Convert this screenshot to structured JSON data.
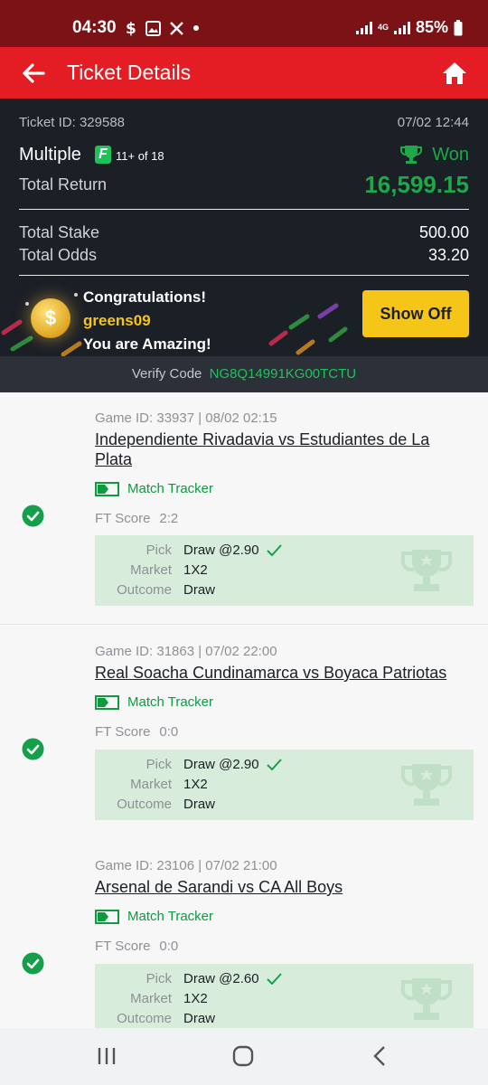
{
  "status_bar": {
    "time": "04:30",
    "battery": "85%",
    "network_tag": "4G"
  },
  "header": {
    "title": "Ticket Details"
  },
  "summary": {
    "ticket_id": "Ticket ID: 329588",
    "date": "07/02 12:44",
    "bet_type": "Multiple",
    "flex_badge": "F",
    "flex_text": "11+ of 18",
    "status": "Won",
    "total_return_label": "Total Return",
    "total_return_value": "16,599.15",
    "total_stake_label": "Total Stake",
    "total_stake_value": "500.00",
    "total_odds_label": "Total Odds",
    "total_odds_value": "33.20"
  },
  "congrats": {
    "line1": "Congratulations!",
    "username": "greens09",
    "line3": "You are Amazing!",
    "coin_symbol": "$",
    "show_off_label": "Show Off"
  },
  "verify": {
    "label": "Verify Code",
    "code": "NG8Q14991KG00TCTU"
  },
  "labels": {
    "match_tracker": "Match Tracker",
    "ft_score": "FT Score",
    "pick": "Pick",
    "market": "Market",
    "outcome": "Outcome"
  },
  "games": [
    {
      "meta": "Game ID: 33937 | 08/02 02:15",
      "title": "Independiente Rivadavia vs Estudiantes de La Plata",
      "ft_score": "2:2",
      "pick": "Draw @2.90",
      "market": "1X2",
      "outcome": "Draw"
    },
    {
      "meta": "Game ID: 31863 | 07/02 22:00",
      "title": "Real Soacha Cundinamarca vs Boyaca Patriotas",
      "ft_score": "0:0",
      "pick": "Draw @2.90",
      "market": "1X2",
      "outcome": "Draw"
    },
    {
      "meta": "Game ID: 23106 | 07/02 21:00",
      "title": "Arsenal de Sarandi vs CA All Boys",
      "ft_score": "0:0",
      "pick": "Draw @2.60",
      "market": "1X2",
      "outcome": "Draw"
    }
  ],
  "icons": {
    "status": [
      "dollar-icon",
      "gallery-icon",
      "x-logo-icon",
      "dot-icon"
    ],
    "header_left": "back-arrow-icon",
    "header_right": "home-icon",
    "won": "trophy-icon",
    "settled": "check-circle-icon",
    "tracker": "match-tracker-icon",
    "pick_ok": "checkmark-icon",
    "nav": [
      "recent-apps-icon",
      "home-circle-icon",
      "back-chevron-icon"
    ]
  },
  "colors": {
    "status_bar": "#7a1216",
    "header": "#e41c24",
    "panel": "#1b1f26",
    "win_green": "#1ea84a",
    "accent_yellow": "#f5c518",
    "pick_box": "#d7ecdb"
  }
}
